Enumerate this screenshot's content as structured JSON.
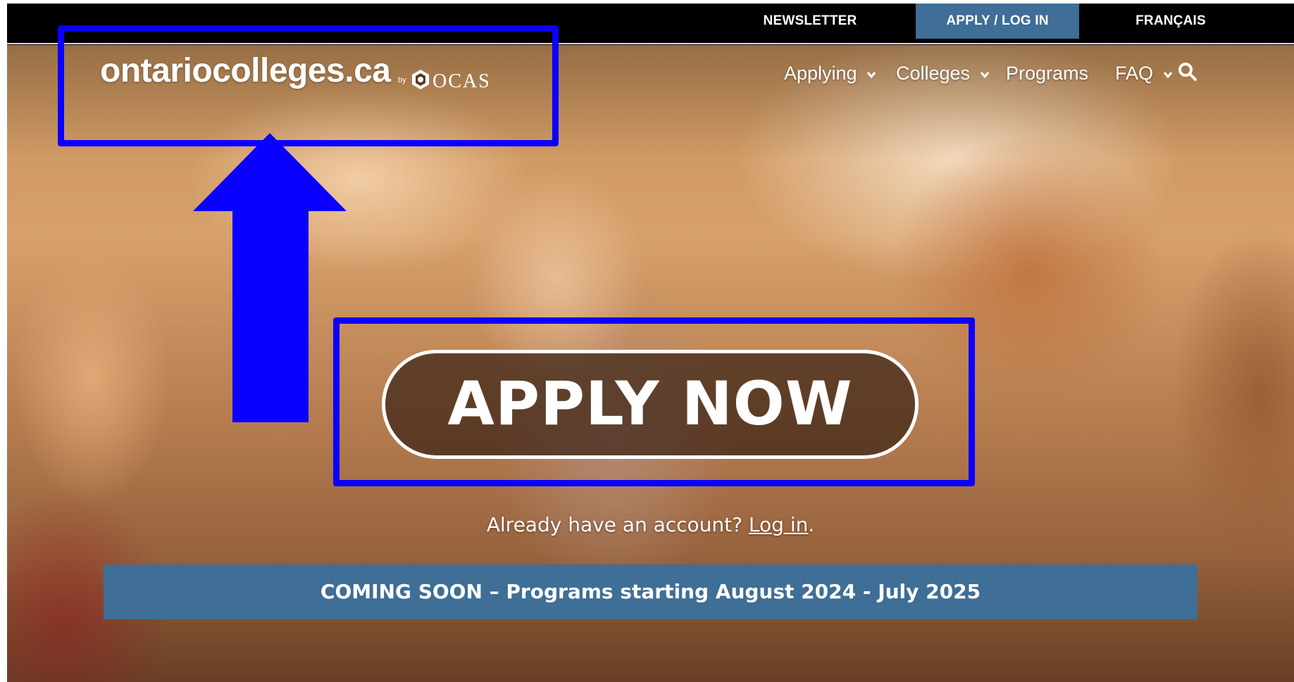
{
  "utility_nav": {
    "newsletter": "NEWSLETTER",
    "apply_login": "APPLY / LOG IN",
    "language": "FRANÇAIS"
  },
  "header": {
    "logo_text": "ontariocolleges.ca",
    "logo_by": "by",
    "logo_partner": "OCAS"
  },
  "main_nav": {
    "items": [
      {
        "label": "Applying",
        "has_dropdown": true
      },
      {
        "label": "Colleges",
        "has_dropdown": true
      },
      {
        "label": "Programs",
        "has_dropdown": false
      },
      {
        "label": "FAQ",
        "has_dropdown": true
      }
    ],
    "search_icon": "search-icon"
  },
  "hero": {
    "cta_label": "APPLY NOW",
    "account_prompt": "Already have an account?",
    "login_link": "Log in",
    "login_suffix": ".",
    "banner": "COMING SOON – Programs starting August 2024 - July 2025"
  },
  "colors": {
    "utility_bar": "#000000",
    "accent_blue": "#3f6e96",
    "annotation": "#0a00ff"
  }
}
